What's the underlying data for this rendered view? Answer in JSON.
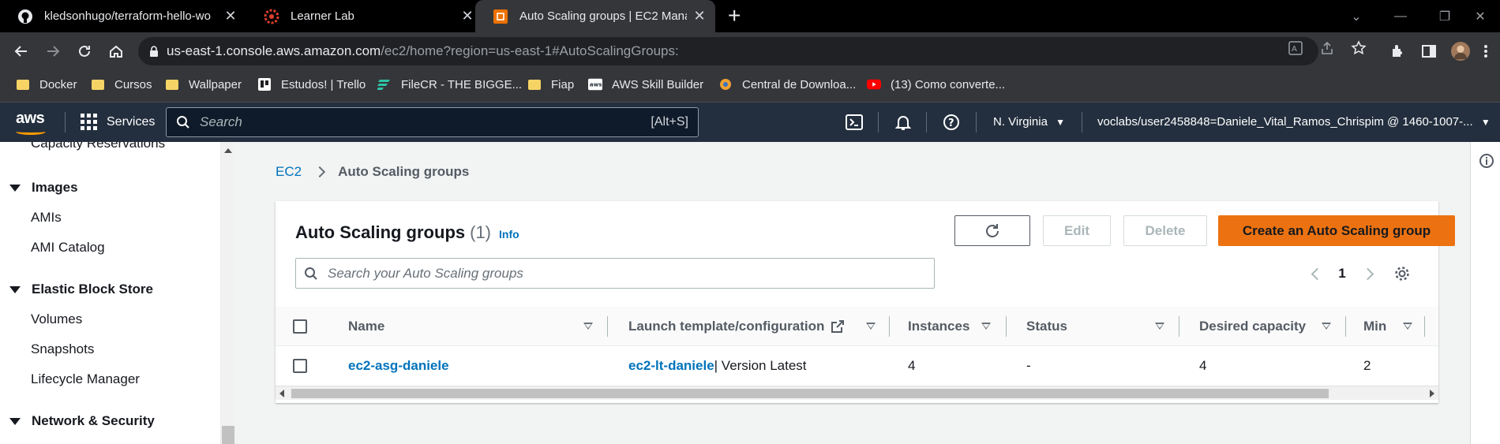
{
  "browser": {
    "tabs": [
      {
        "title": "kledsonhugo/terraform-hello-wo",
        "icon": "github-icon"
      },
      {
        "title": "Learner Lab",
        "icon": "canvas-icon"
      },
      {
        "title": "Auto Scaling groups | EC2 Manag",
        "icon": "ec2-icon"
      }
    ],
    "url_host": "us-east-1.console.aws.amazon.com",
    "url_path": "/ec2/home?region=us-east-1#AutoScalingGroups:",
    "bookmarks": [
      {
        "label": "Docker",
        "icon": "folder-icon"
      },
      {
        "label": "Cursos",
        "icon": "folder-icon"
      },
      {
        "label": "Wallpaper",
        "icon": "folder-icon"
      },
      {
        "label": "Estudos! | Trello",
        "icon": "trello-icon"
      },
      {
        "label": "FileCR - THE BIGGE...",
        "icon": "filecr-icon"
      },
      {
        "label": "Fiap",
        "icon": "folder-icon"
      },
      {
        "label": "AWS Skill Builder",
        "icon": "aws-icon"
      },
      {
        "label": "Central de Downloa...",
        "icon": "download-icon"
      },
      {
        "label": "(13) Como converte...",
        "icon": "youtube-icon"
      }
    ]
  },
  "aws_nav": {
    "logo": "aws",
    "services_label": "Services",
    "search_placeholder": "Search",
    "search_shortcut": "[Alt+S]",
    "region": "N. Virginia",
    "account": "voclabs/user2458848=Daniele_Vital_Ramos_Chrispim @ 1460-1007-..."
  },
  "sidebar": {
    "top_item": "Capacity Reservations",
    "sections": [
      {
        "title": "Images",
        "items": [
          "AMIs",
          "AMI Catalog"
        ]
      },
      {
        "title": "Elastic Block Store",
        "items": [
          "Volumes",
          "Snapshots",
          "Lifecycle Manager"
        ]
      },
      {
        "title": "Network & Security",
        "items": []
      }
    ]
  },
  "breadcrumb": {
    "root": "EC2",
    "current": "Auto Scaling groups"
  },
  "panel": {
    "title": "Auto Scaling groups",
    "count": "(1)",
    "info": "Info",
    "edit_label": "Edit",
    "delete_label": "Delete",
    "create_label": "Create an Auto Scaling group",
    "search_placeholder": "Search your Auto Scaling groups",
    "page": "1"
  },
  "table": {
    "columns": [
      "Name",
      "Launch template/configuration",
      "Instances",
      "Status",
      "Desired capacity",
      "Min"
    ],
    "rows": [
      {
        "name": "ec2-asg-daniele",
        "launch_template": "ec2-lt-daniele",
        "launch_version": " | Version Latest",
        "instances": "4",
        "status": "-",
        "desired": "4",
        "min": "2"
      }
    ]
  },
  "colors": {
    "accent": "#ec7211",
    "link": "#0073bb",
    "nav_bg": "#232f3e"
  }
}
